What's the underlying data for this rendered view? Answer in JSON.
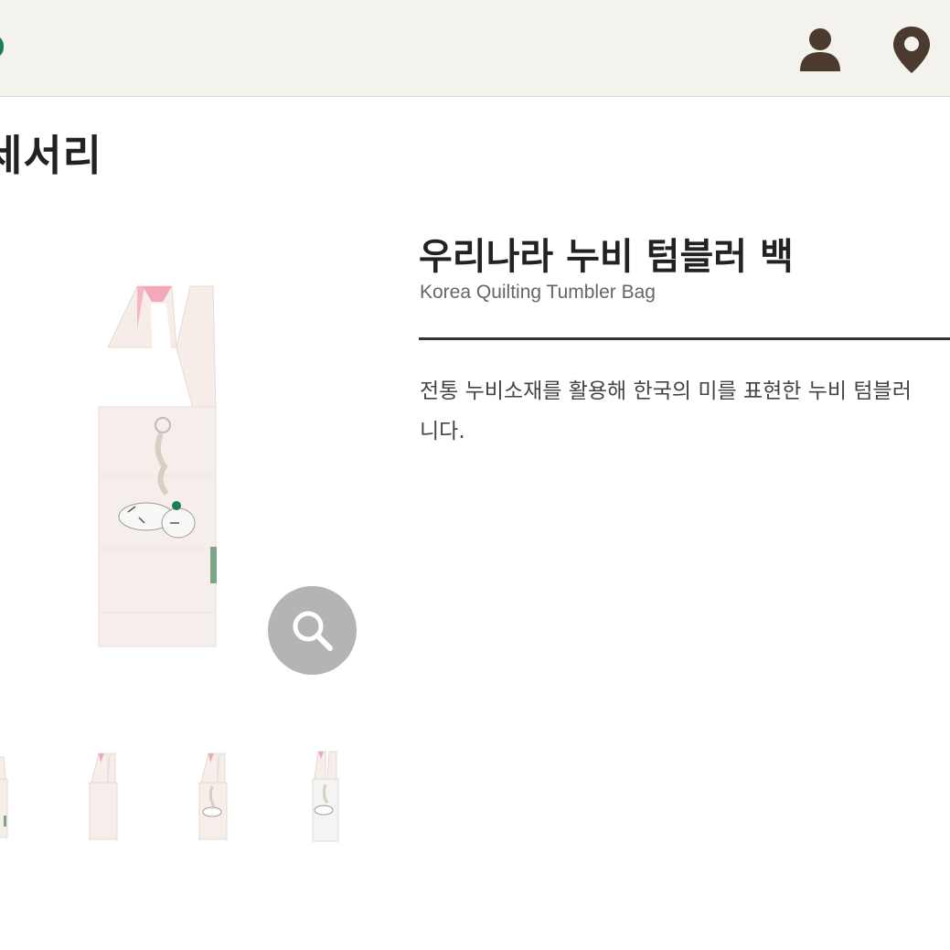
{
  "header": {
    "icons": [
      "user-icon",
      "location-pin-icon"
    ],
    "background": "#f4f2ed",
    "icon_color": "#4b3a2e"
  },
  "page": {
    "title": "세서리"
  },
  "product": {
    "name": "우리나라 누비 텀블러 백",
    "name_en": "Korea Quilting Tumbler Bag",
    "description_line1": "전통 누비소재를 활용해 한국의 미를 표현한 누비 텀블러",
    "description_line2": "니다."
  },
  "gallery": {
    "zoom_icon": "magnifier-icon",
    "thumbnails": 4
  }
}
